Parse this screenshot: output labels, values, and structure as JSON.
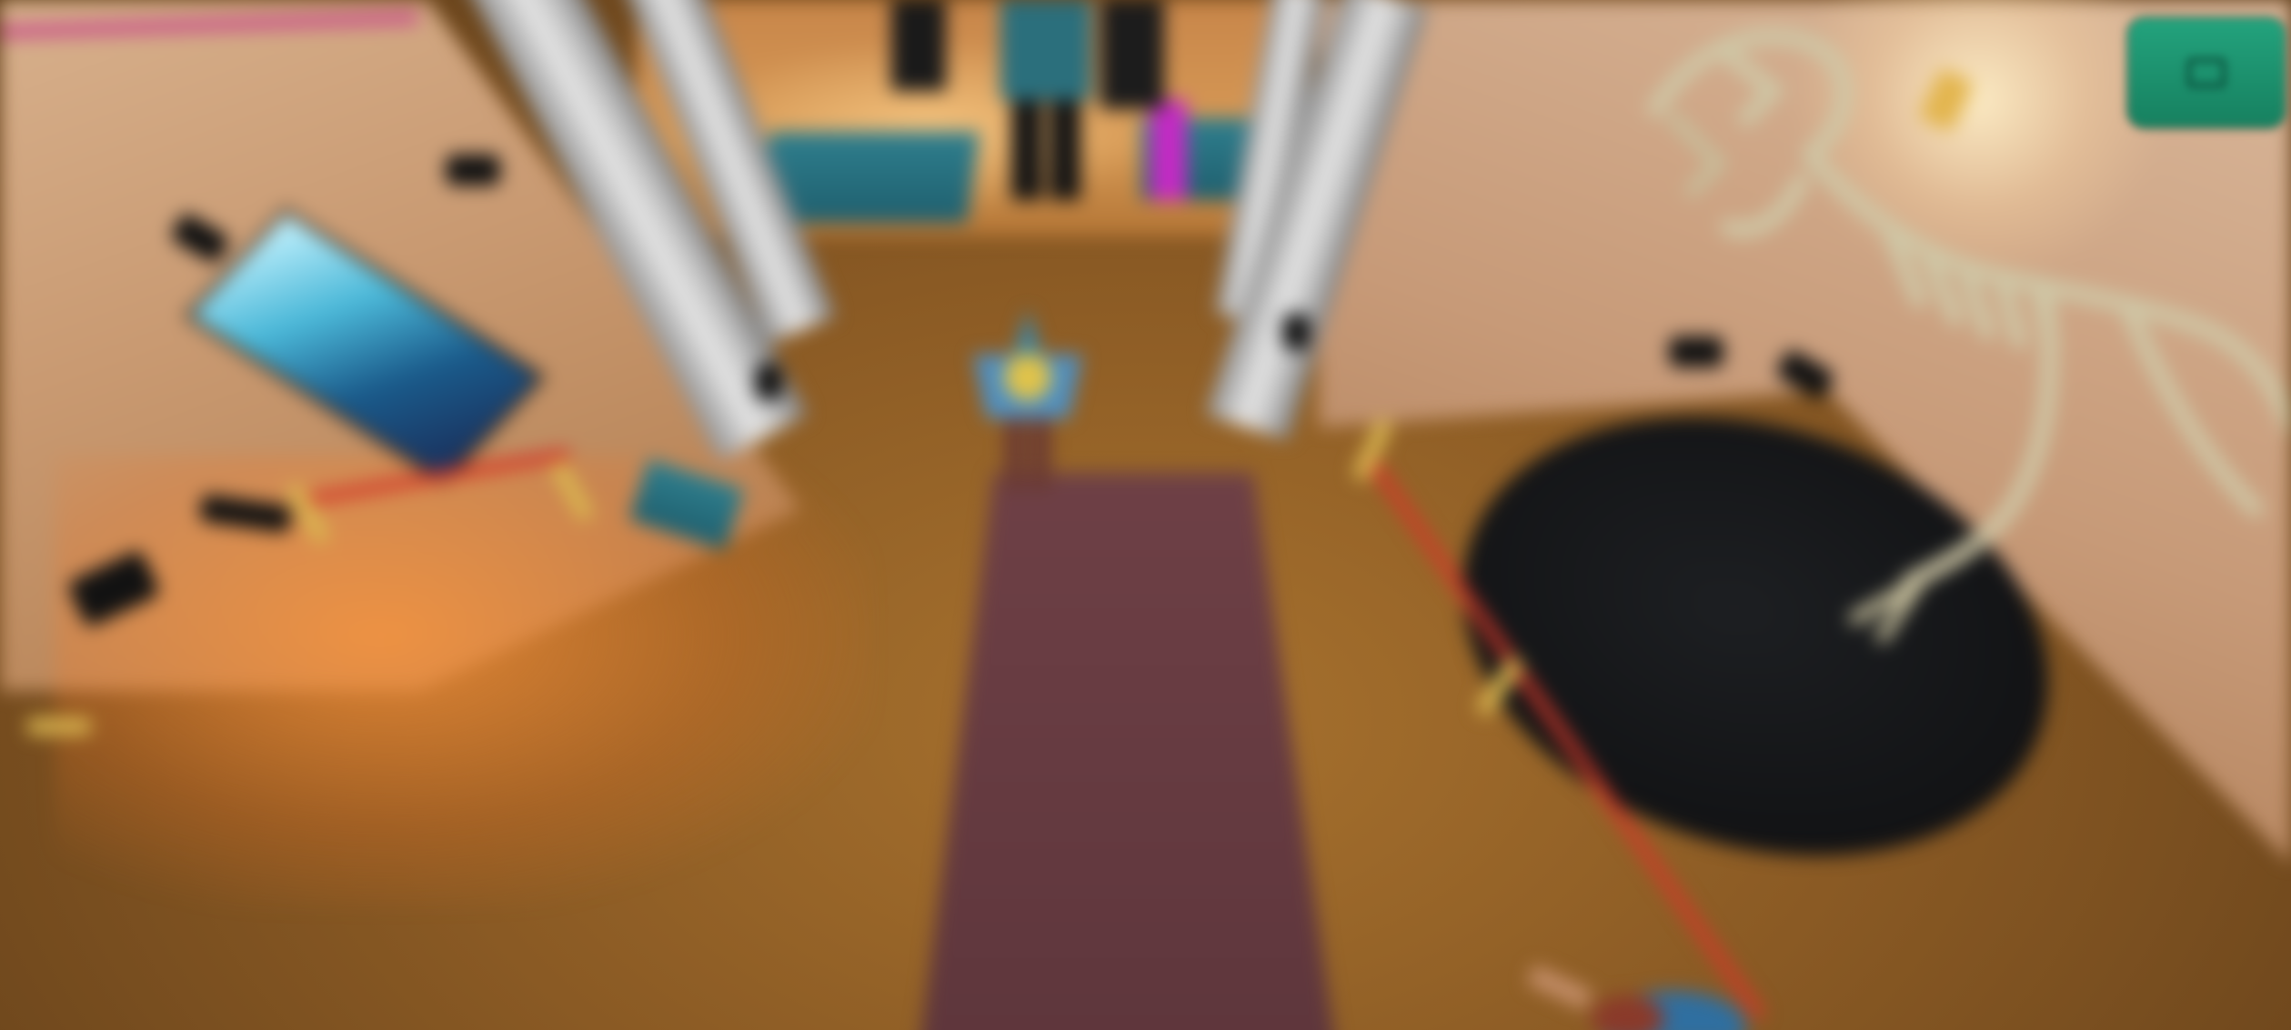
{
  "scene": {
    "name": "museum-hall",
    "view": "third-person-overhead",
    "blurred": true
  },
  "hud": {
    "menu_button": {
      "icon": "menu-icon",
      "color": "#1f9a76"
    }
  },
  "colors": {
    "floor": "#9a6a2e",
    "wall": "#d2a880",
    "carpet": "#6a3d43",
    "pedestal": "#141517",
    "rope": "#d2382a",
    "rope_post": "#d9b550",
    "bench": "#2a7585",
    "hud_button": "#1f9a76"
  }
}
